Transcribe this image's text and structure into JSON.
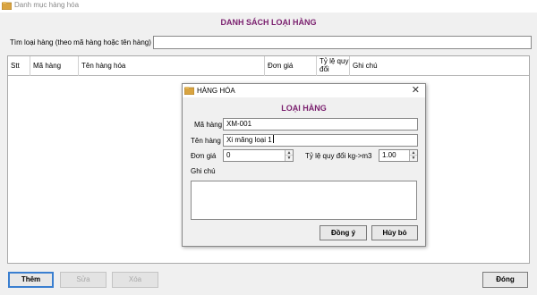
{
  "window": {
    "title": "Danh mục hàng hóa",
    "heading": "DANH SÁCH LOẠI HÀNG"
  },
  "search": {
    "label": "Tìm loại hàng (theo mã hàng hoặc tên hàng)",
    "value": ""
  },
  "grid": {
    "columns": [
      "Stt",
      "Mã hàng",
      "Tên hàng hóa",
      "Đơn giá",
      "Tỷ lệ quy đổi",
      "Ghi chú"
    ]
  },
  "buttons": {
    "add": "Thêm",
    "edit": "Sửa",
    "delete": "Xóa",
    "close": "Đóng"
  },
  "dialog": {
    "title": "HÀNG HÓA",
    "heading": "LOẠI HÀNG",
    "code_label": "Mã hàng",
    "code_value": "XM-001",
    "name_label": "Tên hàng",
    "name_value": "Xi măng loại 1",
    "price_label": "Đơn giá",
    "price_value": "0",
    "ratio_label": "Tỷ lệ quy đổi kg->m3",
    "ratio_value": "1.00",
    "notes_label": "Ghi chú",
    "notes_value": "",
    "ok": "Đồng ý",
    "cancel": "Hủy bỏ"
  },
  "colors": {
    "heading": "#7a1f6e",
    "focus": "#3a7fd0"
  },
  "icons": {
    "app": "folder-icon",
    "close": "close-icon",
    "spin_up": "chevron-up-icon",
    "spin_down": "chevron-down-icon"
  }
}
